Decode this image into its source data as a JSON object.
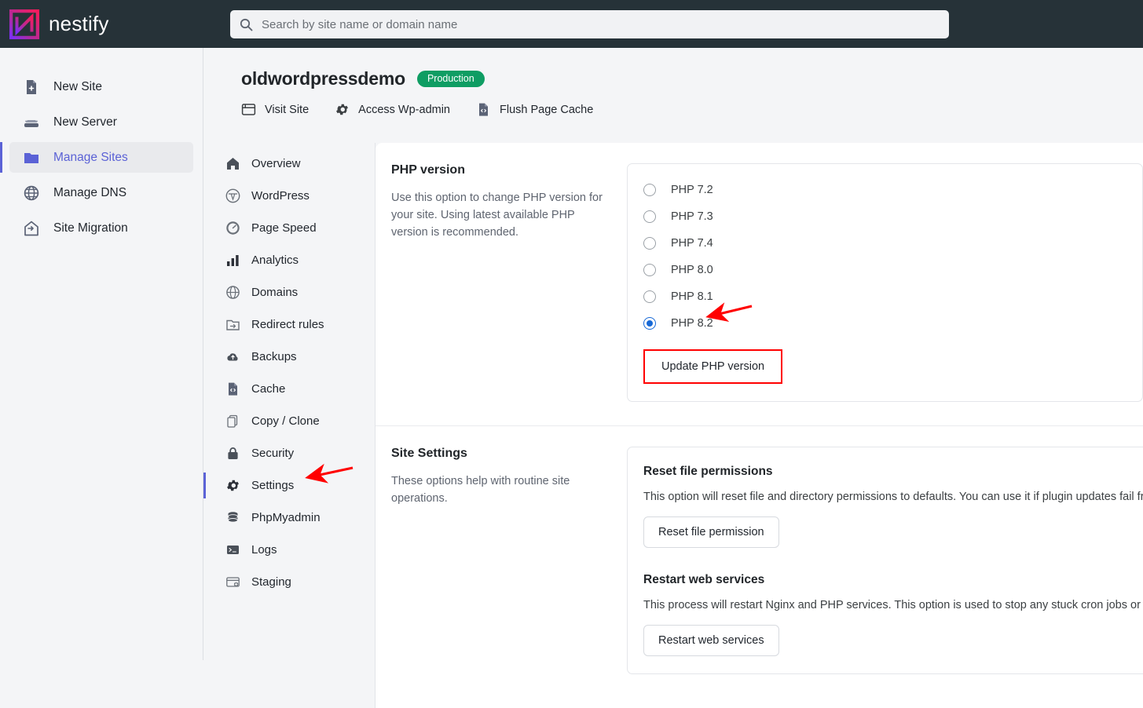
{
  "colors": {
    "topbar_bg": "#263238",
    "accent_purple": "#5b62d6",
    "badge_green": "#0f9d63",
    "radio_blue": "#1769d6",
    "annotation_red": "#ff0000"
  },
  "topbar": {
    "brand_name": "nestify",
    "logo_icon": "nestify-logo-icon",
    "search": {
      "icon": "search-icon",
      "placeholder": "Search by site name or domain name",
      "value": ""
    }
  },
  "sidebar": {
    "items": [
      {
        "label": "New Site",
        "icon": "file-plus-icon",
        "active": false
      },
      {
        "label": "New Server",
        "icon": "server-icon",
        "active": false
      },
      {
        "label": "Manage Sites",
        "icon": "folder-icon",
        "active": true
      },
      {
        "label": "Manage DNS",
        "icon": "globe-icon",
        "active": false
      },
      {
        "label": "Site Migration",
        "icon": "house-transfer-icon",
        "active": false
      }
    ]
  },
  "site_header": {
    "title": "oldwordpressdemo",
    "environment_badge": "Production",
    "quick_actions": [
      {
        "label": "Visit Site",
        "icon": "browser-window-icon"
      },
      {
        "label": "Access Wp-admin",
        "icon": "gear-icon"
      },
      {
        "label": "Flush Page Cache",
        "icon": "file-code-icon"
      }
    ]
  },
  "subnav": {
    "items": [
      {
        "label": "Overview",
        "icon": "home-icon",
        "active": false
      },
      {
        "label": "WordPress",
        "icon": "wordpress-icon",
        "active": false
      },
      {
        "label": "Page Speed",
        "icon": "gauge-icon",
        "active": false
      },
      {
        "label": "Analytics",
        "icon": "bar-chart-icon",
        "active": false
      },
      {
        "label": "Domains",
        "icon": "globe-icon",
        "active": false
      },
      {
        "label": "Redirect rules",
        "icon": "folder-arrow-icon",
        "active": false
      },
      {
        "label": "Backups",
        "icon": "cloud-up-icon",
        "active": false
      },
      {
        "label": "Cache",
        "icon": "file-code-icon",
        "active": false
      },
      {
        "label": "Copy / Clone",
        "icon": "copy-icon",
        "active": false
      },
      {
        "label": "Security",
        "icon": "lock-icon",
        "active": false
      },
      {
        "label": "Settings",
        "icon": "gear-icon",
        "active": true
      },
      {
        "label": "PhpMyadmin",
        "icon": "database-icon",
        "active": false
      },
      {
        "label": "Logs",
        "icon": "terminal-icon",
        "active": false
      },
      {
        "label": "Staging",
        "icon": "browser-plus-icon",
        "active": false
      }
    ]
  },
  "php_version": {
    "title": "PHP version",
    "description": "Use this option to change PHP version for your site. Using latest available PHP version is recommended.",
    "options": [
      {
        "label": "PHP 7.2",
        "selected": false
      },
      {
        "label": "PHP 7.3",
        "selected": false
      },
      {
        "label": "PHP 7.4",
        "selected": false
      },
      {
        "label": "PHP 8.0",
        "selected": false
      },
      {
        "label": "PHP 8.1",
        "selected": false
      },
      {
        "label": "PHP 8.2",
        "selected": true
      }
    ],
    "update_button": "Update PHP version"
  },
  "site_settings": {
    "title": "Site Settings",
    "description": "These options help with routine site operations.",
    "blocks": [
      {
        "heading": "Reset file permissions",
        "description": "This option will reset file and directory permissions to defaults. You can use it if plugin updates fail from",
        "button": "Reset file permission"
      },
      {
        "heading": "Restart web services",
        "description": "This process will restart Nginx and PHP services. This option is used to stop any stuck cron jobs or php i",
        "button": "Restart web services"
      }
    ]
  },
  "annotations": [
    {
      "name": "arrow-to-settings",
      "target": "Settings"
    },
    {
      "name": "arrow-to-php-8-2",
      "target": "PHP 8.2"
    },
    {
      "name": "highlight-update-php",
      "target": "Update PHP version"
    }
  ]
}
